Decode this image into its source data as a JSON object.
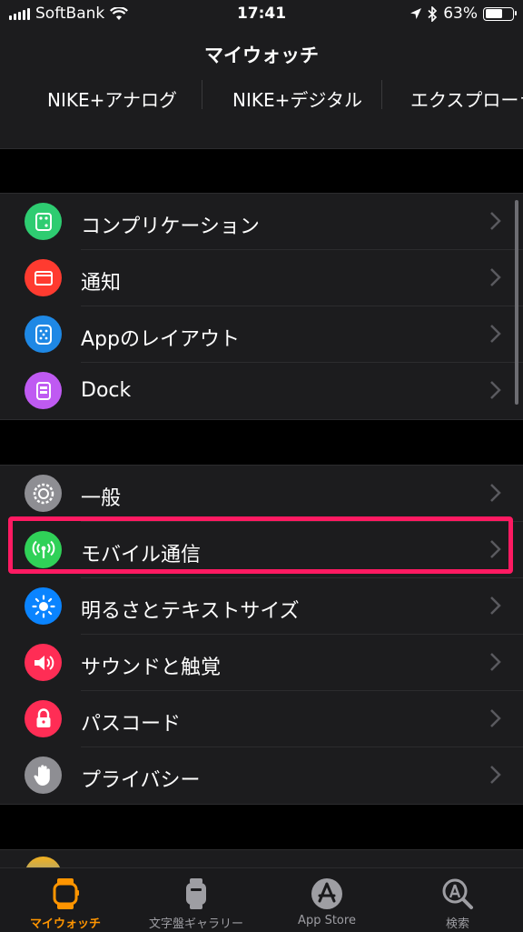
{
  "status_bar": {
    "carrier": "SoftBank",
    "time": "17:41",
    "battery": "63%",
    "battery_level": 0.63
  },
  "nav": {
    "title": "マイウォッチ"
  },
  "faces": [
    "NIKE+アナログ",
    "NIKE+デジタル",
    "エクスプローラ"
  ],
  "settings_group_1": [
    {
      "label": "コンプリケーション",
      "icon": "complications-icon",
      "color": "#2ecc71"
    },
    {
      "label": "通知",
      "icon": "notifications-icon",
      "color": "#ff3b30"
    },
    {
      "label": "Appのレイアウト",
      "icon": "app-layout-icon",
      "color": "#1e88e5"
    },
    {
      "label": "Dock",
      "icon": "dock-icon",
      "color": "#bf5af2"
    }
  ],
  "settings_group_2": [
    {
      "label": "一般",
      "icon": "gear-icon",
      "color": "#8e8e93"
    },
    {
      "label": "モバイル通信",
      "icon": "cellular-icon",
      "color": "#30d158",
      "highlighted": true
    },
    {
      "label": "明るさとテキストサイズ",
      "icon": "brightness-icon",
      "color": "#0a84ff"
    },
    {
      "label": "サウンドと触覚",
      "icon": "sound-icon",
      "color": "#ff2d55"
    },
    {
      "label": "パスコード",
      "icon": "lock-icon",
      "color": "#ff2d55"
    },
    {
      "label": "プライバシー",
      "icon": "hand-icon",
      "color": "#8e8e93"
    }
  ],
  "tab_bar": [
    {
      "label": "マイウォッチ",
      "icon": "watch-icon",
      "active": true
    },
    {
      "label": "文字盤ギャラリー",
      "icon": "face-gallery-icon",
      "active": false
    },
    {
      "label": "App Store",
      "icon": "app-store-icon",
      "active": false
    },
    {
      "label": "検索",
      "icon": "search-icon",
      "active": false
    }
  ],
  "colors": {
    "accent": "#ff9500",
    "highlight": "#ff1a62"
  }
}
